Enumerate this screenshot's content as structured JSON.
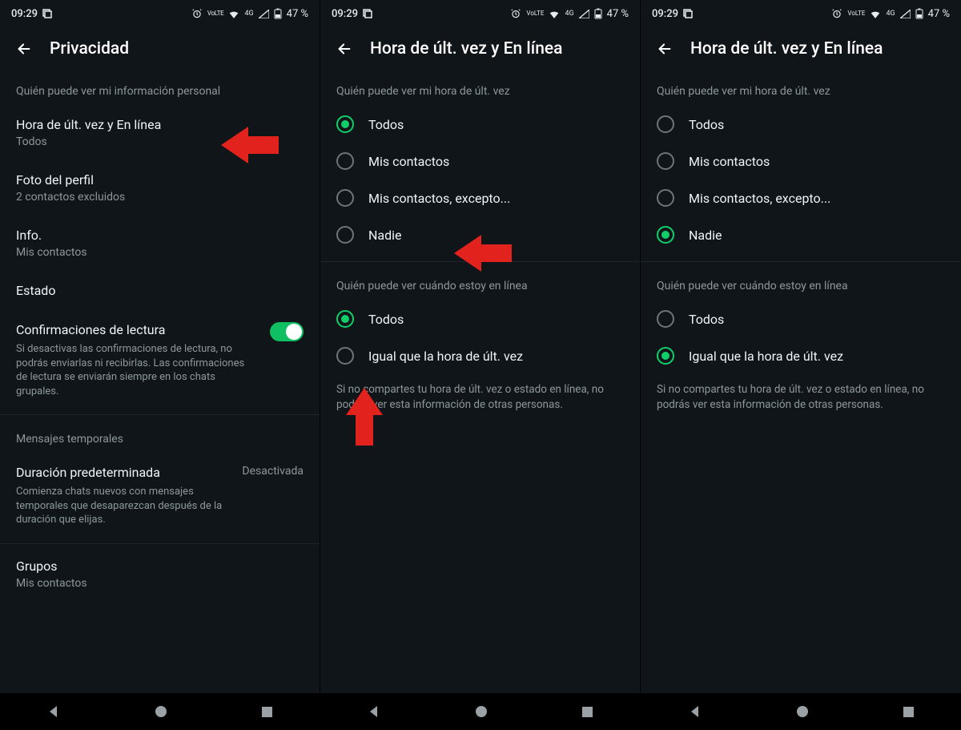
{
  "status": {
    "time": "09:29",
    "volte": "VoLTE",
    "network": "4G",
    "battery": "47 %"
  },
  "screen1": {
    "title": "Privacidad",
    "section1_header": "Quién puede ver mi información personal",
    "last_seen": {
      "label": "Hora de últ. vez y En línea",
      "value": "Todos"
    },
    "photo": {
      "label": "Foto del perfil",
      "value": "2 contactos excluidos"
    },
    "info": {
      "label": "Info.",
      "value": "Mis contactos"
    },
    "status": {
      "label": "Estado"
    },
    "read_receipts": {
      "label": "Confirmaciones de lectura",
      "desc": "Si desactivas las confirmaciones de lectura, no podrás enviarlas ni recibirlas. Las confirmaciones de lectura se enviarán siempre en los chats grupales."
    },
    "temp_header": "Mensajes temporales",
    "default_duration": {
      "label": "Duración predeterminada",
      "desc": "Comienza chats nuevos con mensajes temporales que desaparezcan después de la duración que elijas.",
      "value": "Desactivada"
    },
    "groups": {
      "label": "Grupos",
      "value": "Mis contactos"
    }
  },
  "screen2": {
    "title": "Hora de últ. vez y En línea",
    "section1_header": "Quién puede ver mi hora de últ. vez",
    "opts1": [
      {
        "label": "Todos",
        "selected": true
      },
      {
        "label": "Mis contactos",
        "selected": false
      },
      {
        "label": "Mis contactos, excepto...",
        "selected": false
      },
      {
        "label": "Nadie",
        "selected": false
      }
    ],
    "section2_header": "Quién puede ver cuándo estoy en línea",
    "opts2": [
      {
        "label": "Todos",
        "selected": true
      },
      {
        "label": "Igual que la hora de últ. vez",
        "selected": false
      }
    ],
    "note": "Si no compartes tu hora de últ. vez o estado en línea, no podrás ver esta información de otras personas."
  },
  "screen3": {
    "title": "Hora de últ. vez y En línea",
    "section1_header": "Quién puede ver mi hora de últ. vez",
    "opts1": [
      {
        "label": "Todos",
        "selected": false
      },
      {
        "label": "Mis contactos",
        "selected": false
      },
      {
        "label": "Mis contactos, excepto...",
        "selected": false
      },
      {
        "label": "Nadie",
        "selected": true
      }
    ],
    "section2_header": "Quién puede ver cuándo estoy en línea",
    "opts2": [
      {
        "label": "Todos",
        "selected": false
      },
      {
        "label": "Igual que la hora de últ. vez",
        "selected": true
      }
    ],
    "note": "Si no compartes tu hora de últ. vez o estado en línea, no podrás ver esta información de otras personas."
  }
}
